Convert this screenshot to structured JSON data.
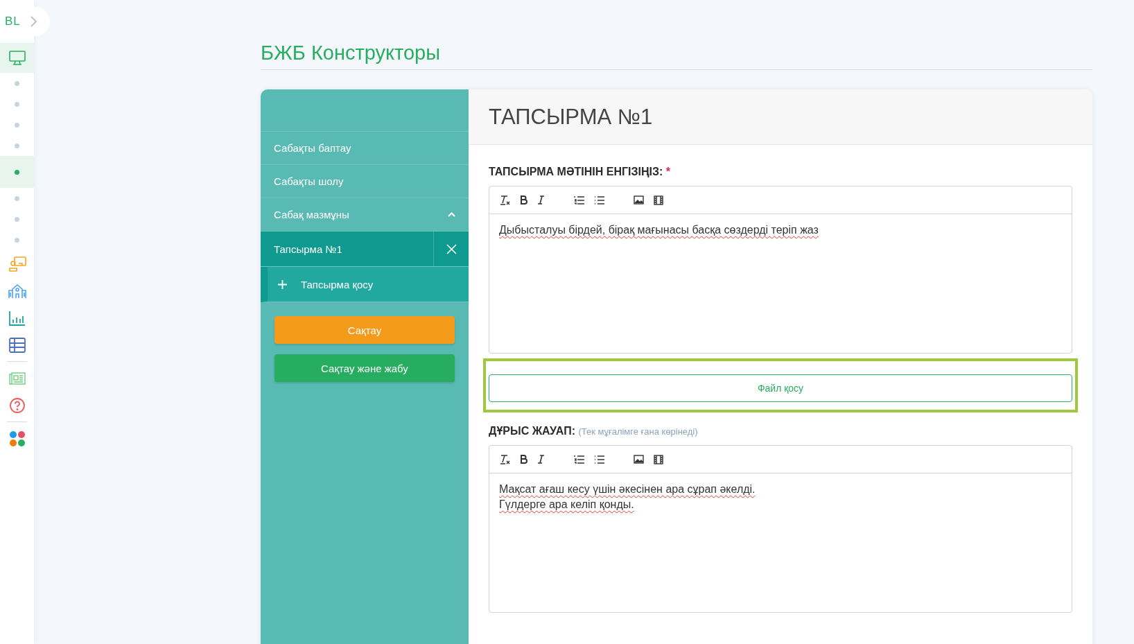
{
  "rail": {
    "logo": "BL",
    "groups": [
      [
        {
          "kind": "monitor",
          "selected": true
        },
        {
          "kind": "dot",
          "selected": false
        },
        {
          "kind": "dot",
          "selected": false
        },
        {
          "kind": "dot",
          "selected": false
        },
        {
          "kind": "dot",
          "selected": false
        },
        {
          "kind": "dot",
          "selected": true
        },
        {
          "kind": "dot",
          "selected": false
        },
        {
          "kind": "dot",
          "selected": false
        },
        {
          "kind": "dot",
          "selected": false
        },
        {
          "kind": "teacher",
          "selected": false
        },
        {
          "kind": "school",
          "selected": false
        },
        {
          "kind": "chart",
          "selected": false
        },
        {
          "kind": "table",
          "selected": false
        }
      ],
      [
        {
          "kind": "news",
          "selected": false
        },
        {
          "kind": "help",
          "selected": false
        }
      ],
      [
        {
          "kind": "apps",
          "selected": false
        }
      ]
    ]
  },
  "page_title": "БЖБ Конструкторы",
  "menu": [
    {
      "kind": "item",
      "label": "Сабақты баптау",
      "selected": false
    },
    {
      "kind": "item",
      "label": "Сабақты шолу",
      "selected": false
    },
    {
      "kind": "group",
      "label": "Сабақ мазмұны",
      "expanded": true,
      "selected": false
    },
    {
      "kind": "task",
      "label": "Тапсырма №1",
      "selected": true
    },
    {
      "kind": "add",
      "label": "Тапсырма қосу"
    }
  ],
  "buttons": [
    {
      "kind": "save",
      "label": "Сақтау"
    },
    {
      "kind": "save_close",
      "label": "Сақтау және жабу"
    }
  ],
  "task": {
    "title": "ТАПСЫРМА №1",
    "question": {
      "label": "ТАПСЫРМА МӘТІНІН ЕНГІЗІҢІЗ:",
      "required_mark": "*",
      "lines": [
        "Дыбысталуы бірдей, бірақ мағынасы басқа сөздерді теріп жаз"
      ]
    },
    "file_button": {
      "label": "Файл қосу",
      "highlighted": true
    },
    "answer": {
      "label": "ДҰРЫС ЖАУАП:",
      "hint": "(Тек мұғалімге ғана көрінеді)",
      "lines": [
        "Мақсат ағаш кесу үшін әкесінен ара сұрап әкелді.",
        "Гүлдерге ара келіп қонды."
      ]
    }
  }
}
